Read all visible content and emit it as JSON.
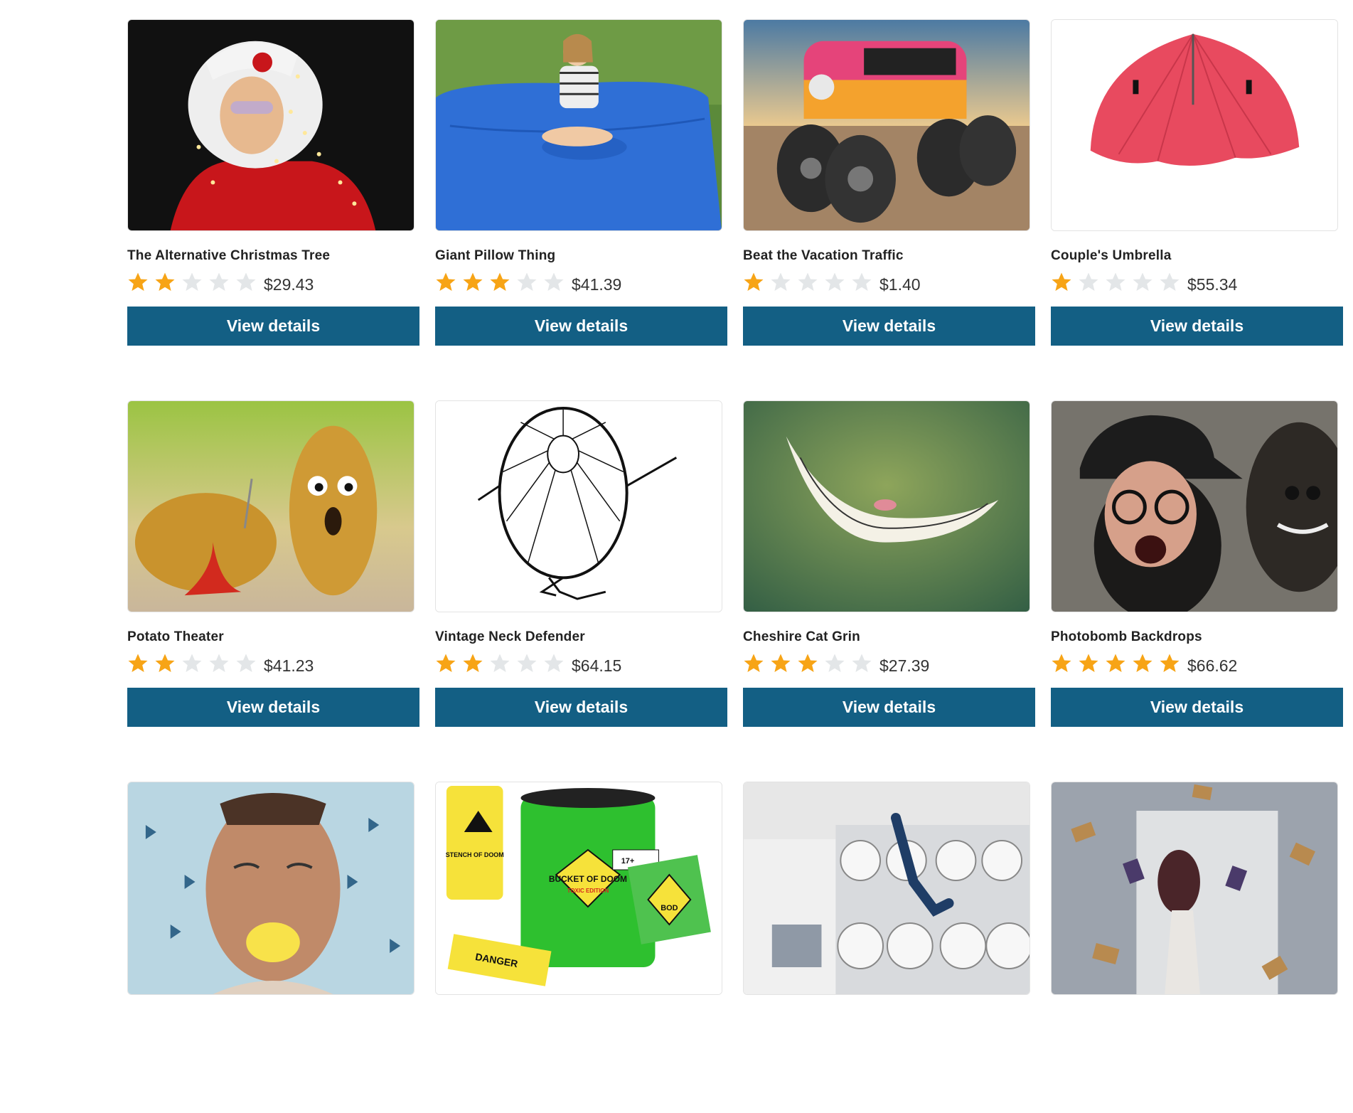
{
  "products": [
    {
      "title": "The Alternative Christmas Tree",
      "rating": 2,
      "price": "$29.43",
      "button": "View details",
      "image": "santa-lights"
    },
    {
      "title": "Giant Pillow Thing",
      "rating": 3,
      "price": "$41.39",
      "button": "View details",
      "image": "blue-pillow"
    },
    {
      "title": "Beat the Vacation Traffic",
      "rating": 1,
      "price": "$1.40",
      "button": "View details",
      "image": "monster-van"
    },
    {
      "title": "Couple's Umbrella",
      "rating": 1,
      "price": "$55.34",
      "button": "View details",
      "image": "red-umbrella"
    },
    {
      "title": "Potato Theater",
      "rating": 2,
      "price": "$41.23",
      "button": "View details",
      "image": "potatoes"
    },
    {
      "title": "Vintage Neck Defender",
      "rating": 2,
      "price": "$64.15",
      "button": "View details",
      "image": "neck-defender"
    },
    {
      "title": "Cheshire Cat Grin",
      "rating": 3,
      "price": "$27.39",
      "button": "View details",
      "image": "cheshire-grin"
    },
    {
      "title": "Photobomb Backdrops",
      "rating": 5,
      "price": "$66.62",
      "button": "View details",
      "image": "photobomb"
    },
    {
      "image": "lemon-face"
    },
    {
      "image": "bucket-of-doom",
      "image_text": [
        "BUCKET OF DOOM",
        "TOXIC EDITION",
        "STENCH OF DOOM",
        "DANGER",
        "BOD",
        "17+"
      ]
    },
    {
      "image": "laundromat"
    },
    {
      "image": "flying-books"
    }
  ],
  "colors": {
    "button": "#135f84",
    "star_filled": "#f7a416",
    "star_empty": "#e3e6e8"
  }
}
